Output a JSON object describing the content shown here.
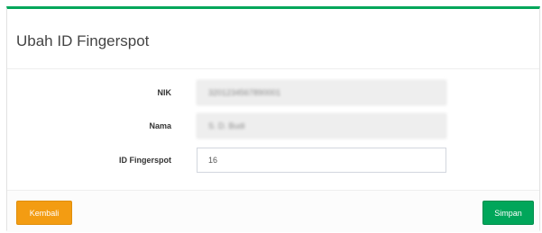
{
  "panel": {
    "title": "Ubah ID Fingerspot",
    "accent_color": "#00a65a"
  },
  "form": {
    "nik": {
      "label": "NIK",
      "value": "3201234567890001",
      "readonly": true,
      "blurred": true
    },
    "nama": {
      "label": "Nama",
      "value": "S. D. Budi",
      "readonly": true,
      "blurred": true
    },
    "id_fingerspot": {
      "label": "ID Fingerspot",
      "value": "16",
      "readonly": false
    }
  },
  "footer": {
    "back_label": "Kembali",
    "back_color": "#f39c12",
    "save_label": "Simpan",
    "save_color": "#00a65a"
  }
}
